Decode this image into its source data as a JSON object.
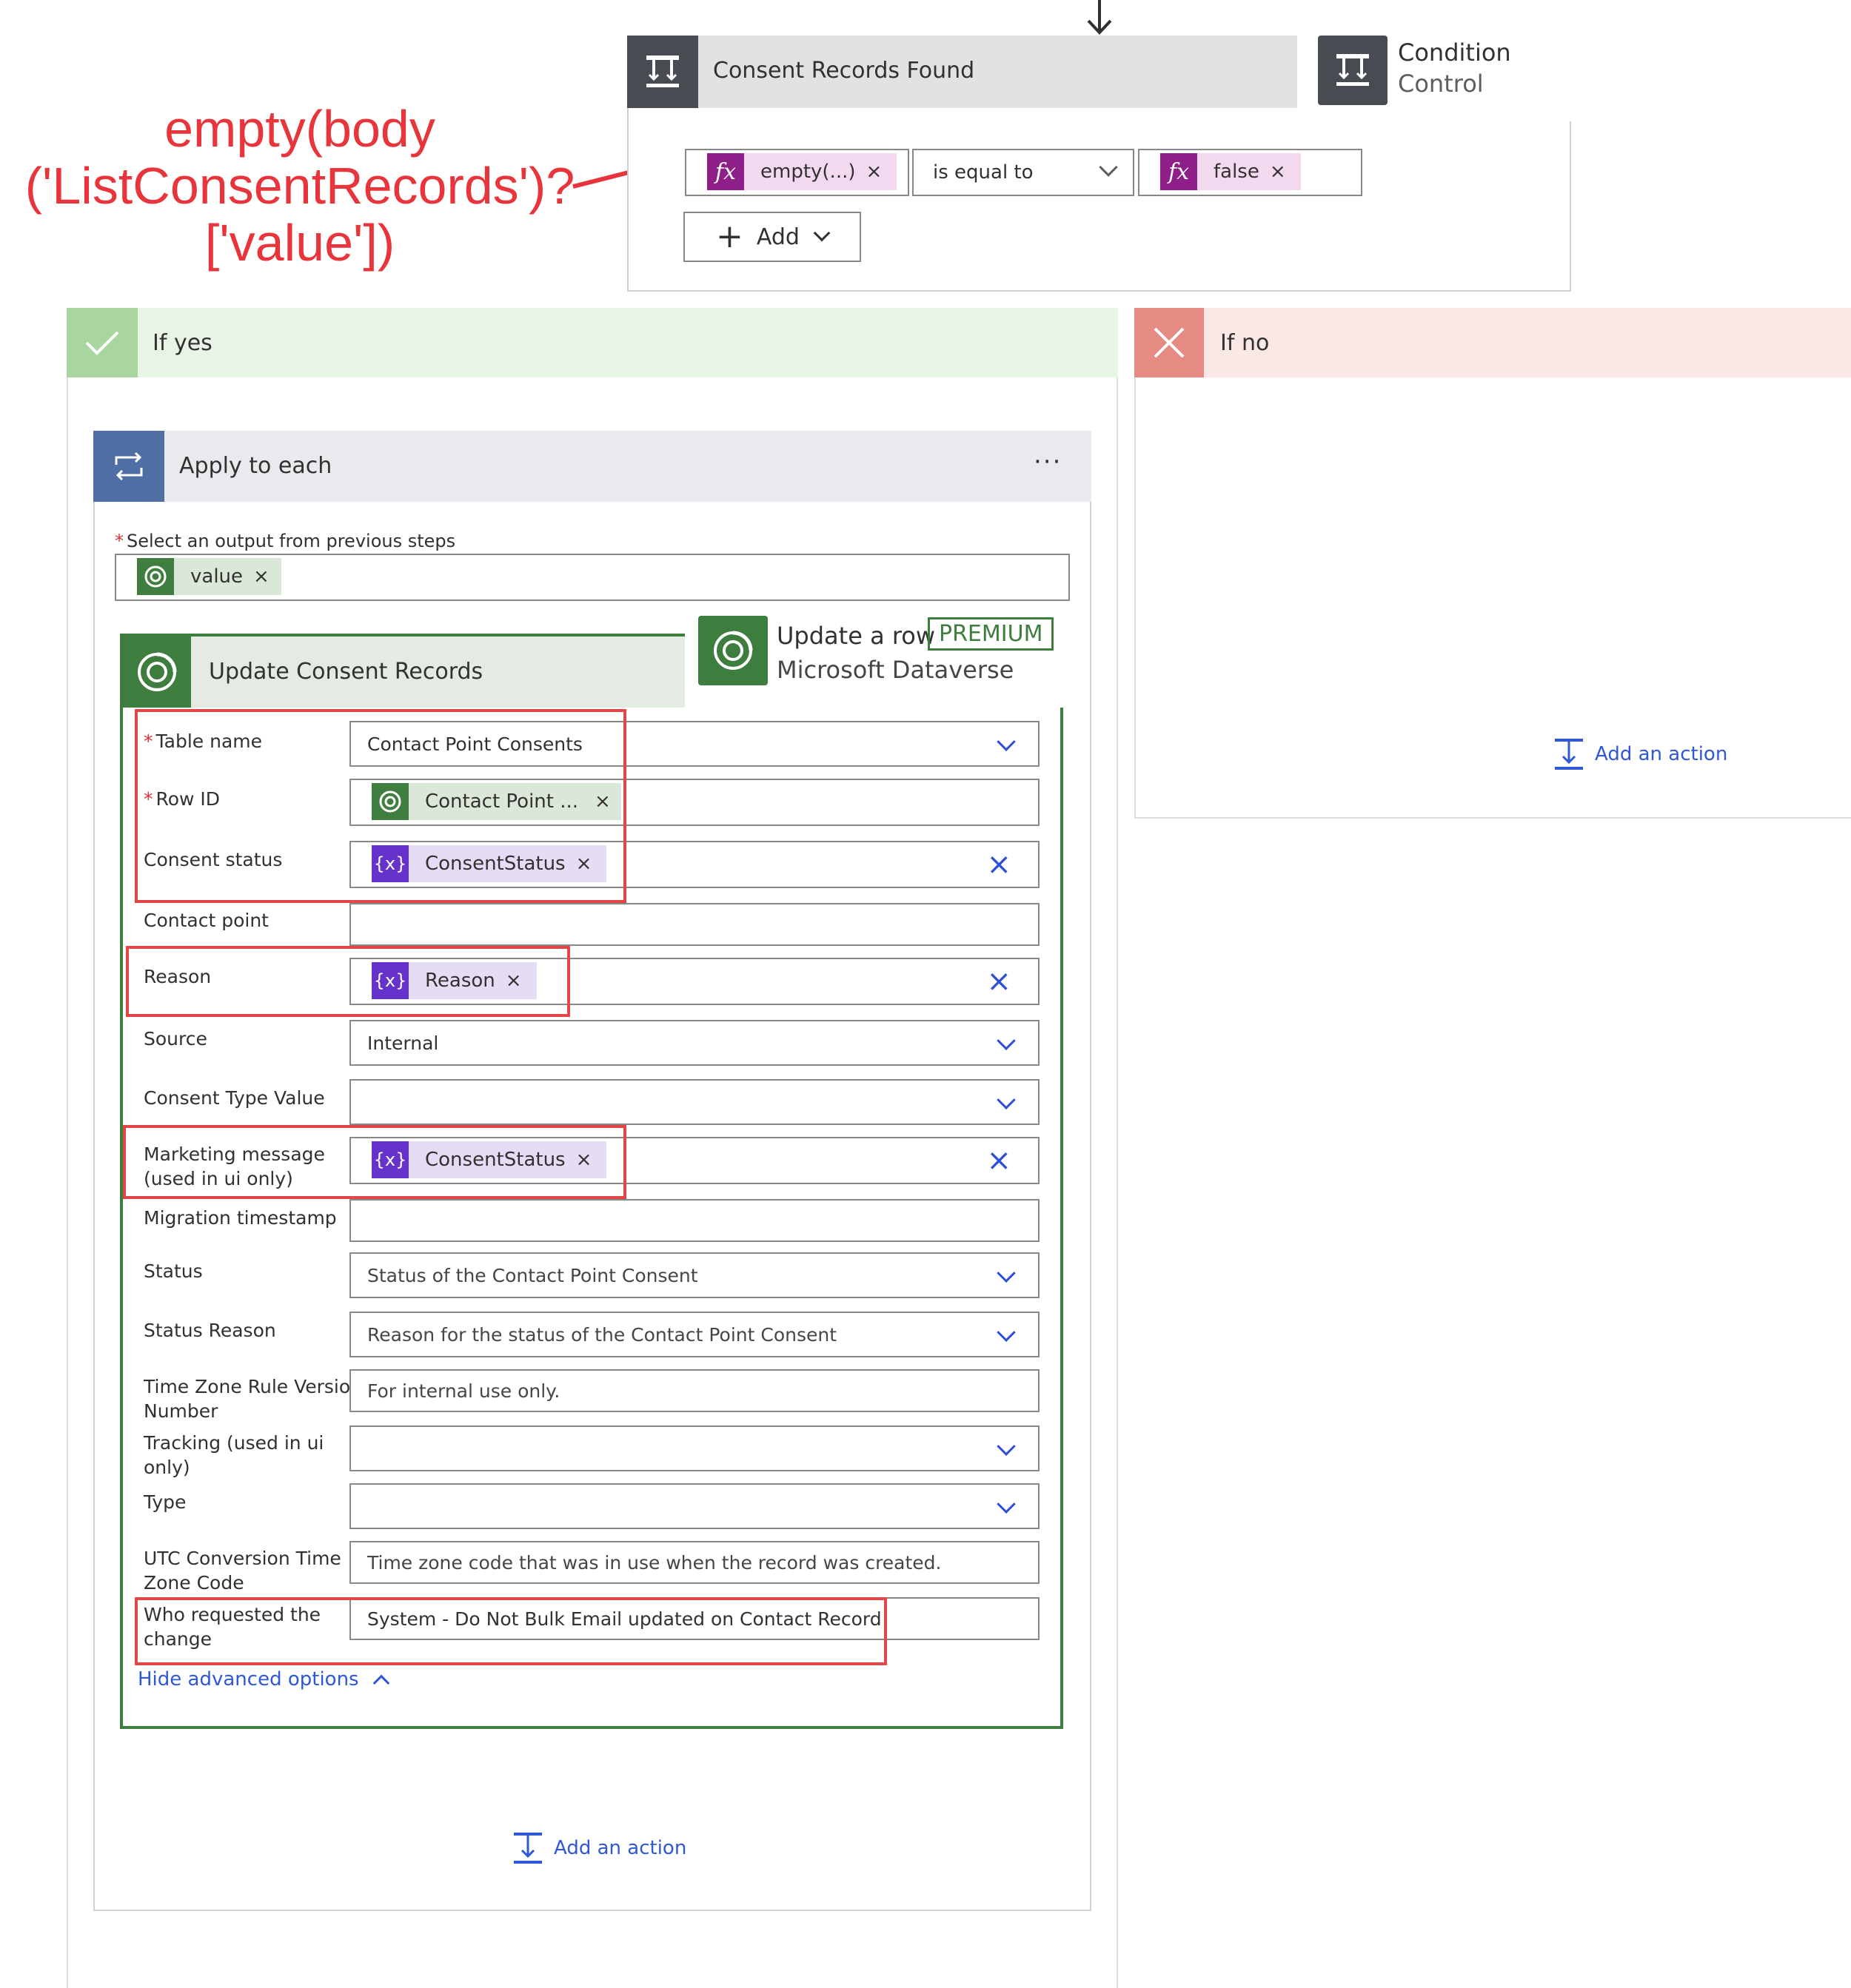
{
  "annotation": {
    "line1": "empty(body",
    "line2": "('ListConsentRecords')?",
    "line3": "['value'])"
  },
  "condition": {
    "title": "Consent Records Found",
    "tooltip_title": "Condition",
    "tooltip_subtitle": "Control",
    "left_token": "empty(...)",
    "operator": "is equal to",
    "right_token": "false",
    "add_label": "Add",
    "fx_glyph": "fx"
  },
  "if_yes": {
    "label": "If yes"
  },
  "if_no": {
    "label": "If no",
    "add_action": "Add an action"
  },
  "apply": {
    "title": "Apply to each",
    "more": "···",
    "select_label": "Select an output from previous steps",
    "value_token": "value",
    "add_action": "Add an action"
  },
  "update": {
    "title": "Update Consent Records",
    "tooltip_title": "Update a row",
    "tooltip_badge": "PREMIUM",
    "tooltip_subtitle": "Microsoft Dataverse",
    "hide_advanced": "Hide advanced options",
    "var_glyph": "{x}",
    "fields": {
      "table_name": {
        "label": "Table name",
        "value": "Contact Point Consents"
      },
      "row_id": {
        "label": "Row ID",
        "token": "Contact Point ..."
      },
      "consent_status": {
        "label": "Consent status",
        "token": "ConsentStatus"
      },
      "contact_point": {
        "label": "Contact point"
      },
      "reason": {
        "label": "Reason",
        "token": "Reason"
      },
      "source": {
        "label": "Source",
        "value": "Internal"
      },
      "consent_type_value": {
        "label": "Consent Type Value"
      },
      "marketing_message": {
        "label1": "Marketing message",
        "label2": "(used in ui only)",
        "token": "ConsentStatus"
      },
      "migration_timestamp": {
        "label": "Migration timestamp"
      },
      "status": {
        "label": "Status",
        "placeholder": "Status of the Contact Point Consent"
      },
      "status_reason": {
        "label": "Status Reason",
        "placeholder": "Reason for the status of the Contact Point Consent"
      },
      "tz_rule": {
        "label1": "Time Zone Rule Version",
        "label2": "Number",
        "placeholder": "For internal use only."
      },
      "tracking": {
        "label1": "Tracking (used in ui",
        "label2": "only)"
      },
      "type": {
        "label": "Type"
      },
      "utc": {
        "label1": "UTC Conversion Time",
        "label2": "Zone Code",
        "placeholder": "Time zone code that was in use when the record was created."
      },
      "who": {
        "label1": "Who requested the",
        "label2": "change",
        "value": "System - Do Not Bulk Email updated on Contact Record"
      }
    }
  },
  "colors": {
    "annotation_red": "#e8353b",
    "link_blue": "#2f58d9",
    "dataverse_green": "#3d7d3d",
    "expression_purple": "#8e1f89",
    "variable_purple": "#6532cc"
  }
}
